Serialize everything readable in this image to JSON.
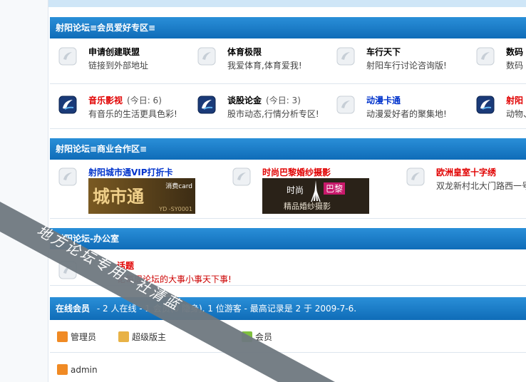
{
  "sections": {
    "member": {
      "title": "射阳论坛≡会员爱好专区≡",
      "forums": [
        {
          "title": "申请创建联盟",
          "desc": "链接到外部地址",
          "color": "black",
          "today": ""
        },
        {
          "title": "体育极限",
          "desc": "我爱体育,体育爱我!",
          "color": "black",
          "today": ""
        },
        {
          "title": "车行天下",
          "desc": "射阳车行讨论咨询版!",
          "color": "black",
          "today": ""
        },
        {
          "title": "数码",
          "desc": "数码",
          "color": "black",
          "today": ""
        },
        {
          "title": "音乐影视",
          "desc": "有音乐的生活更具色彩!",
          "color": "red",
          "today": "(今日: 6)"
        },
        {
          "title": "谈股论金",
          "desc": "股市动态,行情分析专区!",
          "color": "black",
          "today": "(今日: 3)"
        },
        {
          "title": "动漫卡通",
          "desc": "动漫爱好者的聚集地!",
          "color": "blue",
          "today": ""
        },
        {
          "title": "射阳",
          "desc": "动物、",
          "color": "red",
          "today": ""
        }
      ]
    },
    "business": {
      "title": "射阳论坛≡商业合作区≡",
      "forums": [
        {
          "title": "射阳城市通VIP打折卡",
          "color": "blue",
          "banner": {
            "left": "城市通",
            "right": "消费card",
            "code": "YD -SY0001"
          }
        },
        {
          "title": "时尚巴黎婚纱摄影",
          "color": "red",
          "banner": {
            "top_left": "时尚",
            "top_right": "巴黎",
            "bottom": "精品婚纱摄影"
          }
        },
        {
          "title": "欧洲皇室十字绣",
          "color": "red",
          "desc": "双龙新村北大门路西一号"
        }
      ]
    },
    "office": {
      "title": "射阳论坛-办公室",
      "forums": [
        {
          "title": "话题",
          "desc": "论每周论坛的大事小事天下事!",
          "color": "red"
        }
      ]
    }
  },
  "online": {
    "label": "在线会员",
    "text": "- 2 人在线 - 1 会员(0 隐身), 1 位游客 - 最高记录是 2 于 2009-7-6.",
    "legend": [
      {
        "label": "管理员",
        "icon": "admin-user-icon",
        "color": "#f08a24"
      },
      {
        "label": "超级版主",
        "icon": "super-mod-user-icon",
        "color": "#e8b246"
      },
      {
        "label": "会员",
        "icon": "member-user-icon",
        "color": "#7fbf3f"
      }
    ],
    "users": [
      {
        "name": "admin"
      }
    ]
  },
  "watermark": "地方论坛专用--社清蓝"
}
